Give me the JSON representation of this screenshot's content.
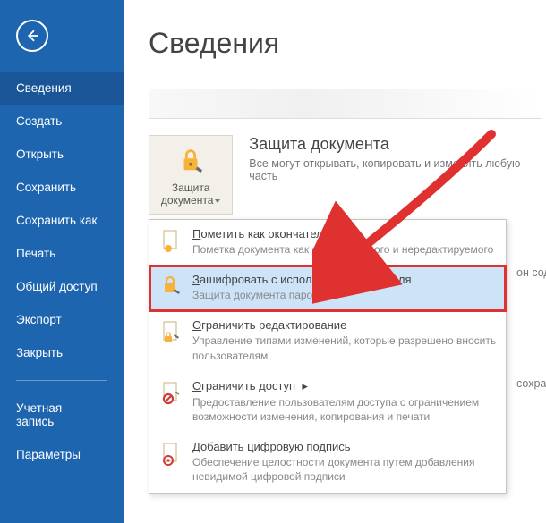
{
  "sidebar": {
    "items": [
      {
        "label": "Сведения",
        "active": true
      },
      {
        "label": "Создать"
      },
      {
        "label": "Открыть"
      },
      {
        "label": "Сохранить"
      },
      {
        "label": "Сохранить как"
      },
      {
        "label": "Печать"
      },
      {
        "label": "Общий доступ"
      },
      {
        "label": "Экспорт"
      },
      {
        "label": "Закрыть"
      }
    ],
    "footer": [
      {
        "label": "Учетная\nзапись"
      },
      {
        "label": "Параметры"
      }
    ]
  },
  "page": {
    "title": "Сведения"
  },
  "protect": {
    "button_label": "Защита документа",
    "heading": "Защита документа",
    "subtext": "Все могут открывать, копировать и изменять любую часть"
  },
  "dropdown": [
    {
      "icon": "flag-icon",
      "title_u": "П",
      "title_rest": "ометить как окончательный",
      "desc": "Пометка документа как окончательного и нередактируемого"
    },
    {
      "icon": "lock-key-icon",
      "title_u": "З",
      "title_rest": "ашифровать с использованием пароля",
      "desc": "Защита документа паролем",
      "highlight": true
    },
    {
      "icon": "lock-pencil-icon",
      "title_u": "О",
      "title_rest": "граничить редактирование",
      "desc": "Управление типами изменений, которые разрешено вносить пользователям"
    },
    {
      "icon": "restrict-access-icon",
      "title_u": "О",
      "title_rest": "граничить доступ",
      "desc": "Предоставление пользователям доступа с ограничением возможности изменения, копирования и печати"
    },
    {
      "icon": "signature-icon",
      "title_u": "Д",
      "title_rest": "обавить цифровую подпись",
      "desc": "Обеспечение целостности документа путем добавления невидимой цифровой подписи"
    }
  ],
  "trailing": {
    "contains": "он содер",
    "saved": "сохранен"
  }
}
